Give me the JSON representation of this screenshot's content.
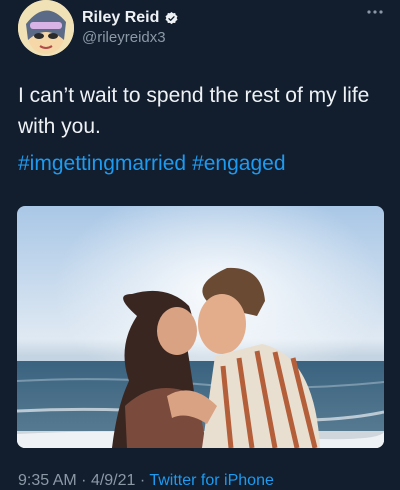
{
  "tweet": {
    "author": {
      "display_name": "Riley Reid",
      "handle": "@rileyreidx3",
      "verified": true
    },
    "text": "I can’t wait to spend the rest of my life with you.",
    "hashtags": [
      "#imgettingmarried",
      "#engaged"
    ],
    "media": {
      "alt": "photo"
    },
    "meta": {
      "time": "9:35 AM",
      "separator": "·",
      "date": "4/9/21",
      "source": "Twitter for iPhone"
    }
  },
  "icons": [
    "verified-badge-icon",
    "more-options-icon"
  ],
  "colors": {
    "background": "#121d2e",
    "link": "#1d9bf0",
    "muted": "#8b98a5",
    "text": "#eef2f5"
  }
}
